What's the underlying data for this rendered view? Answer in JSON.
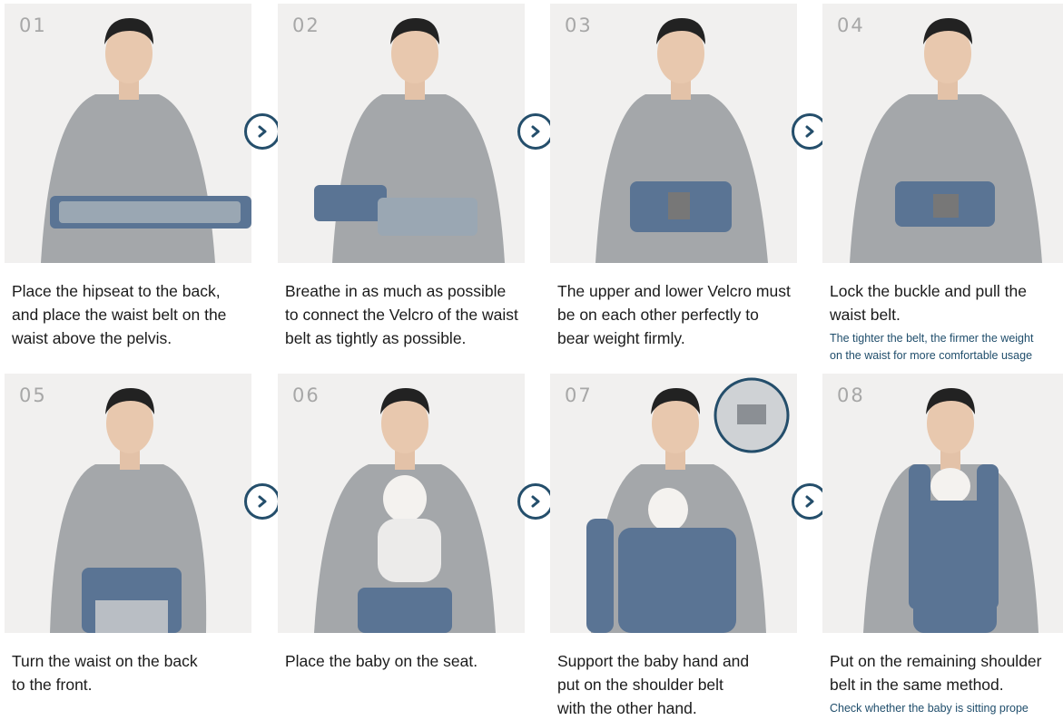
{
  "colors": {
    "accent": "#244e6b",
    "note_text": "#1f4d6b",
    "photo_bg": "#f1f0ef",
    "sweater": "#a4a7aa",
    "belt": "#5a7494"
  },
  "steps": [
    {
      "number": "01",
      "description": "Place the hipseat to the back,\nand place the waist belt on the\nwaist above the pelvis.",
      "note": ""
    },
    {
      "number": "02",
      "description": "Breathe in as much as possible\nto connect the Velcro of the waist\nbelt as tightly as possible.",
      "note": ""
    },
    {
      "number": "03",
      "description": "The upper and lower Velcro must\nbe on each other perfectly to\nbear weight firmly.",
      "note": ""
    },
    {
      "number": "04",
      "description": "Lock the buckle and pull the\nwaist belt.",
      "note": "The tighter the belt, the firmer the weight\non the waist for more comfortable usage"
    },
    {
      "number": "05",
      "description": "Turn the waist on the back\nto the front.",
      "note": ""
    },
    {
      "number": "06",
      "description": "Place the baby on the seat.",
      "note": ""
    },
    {
      "number": "07",
      "description": "Support the baby hand and\nput on the shoulder belt\nwith the other hand.",
      "note": ""
    },
    {
      "number": "08",
      "description": "Put on the remaining shoulder\nbelt in the same method.",
      "note": "Check whether the baby is sitting prope"
    }
  ],
  "icons": {
    "next": "chevron-right-icon"
  }
}
